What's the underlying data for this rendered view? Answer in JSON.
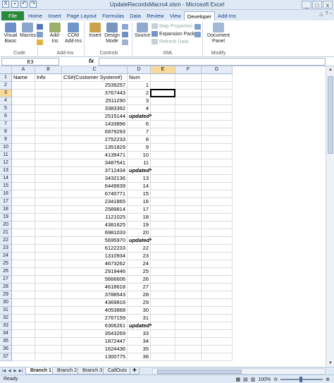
{
  "window": {
    "title": "UpdateRecordsMacro4.xlsm - Microsoft Excel",
    "buttons": [
      "_",
      "□",
      "x"
    ]
  },
  "quick_access": [
    "save-icon",
    "undo-icon",
    "redo-icon"
  ],
  "ribbon_tabs": [
    "File",
    "Home",
    "Insert",
    "Page Layout",
    "Formulas",
    "Data",
    "Review",
    "View",
    "Developer",
    "Add-Ins"
  ],
  "active_tab": "Developer",
  "ribbon": {
    "code": {
      "label": "Code",
      "visual_basic": "Visual\nBasic",
      "macros": "Macros"
    },
    "addins": {
      "label": "Add-Ins",
      "addins": "Add-Ins",
      "com": "COM\nAdd-Ins"
    },
    "controls": {
      "label": "Controls",
      "insert": "Insert",
      "design": "Design\nMode"
    },
    "xml": {
      "label": "XML",
      "source": "Source",
      "map_properties": "Map Properties",
      "expansion_packs": "Expansion Packs",
      "refresh_data": "Refresh Data"
    },
    "modify": {
      "label": "Modify",
      "document_panel": "Document\nPanel"
    }
  },
  "formula_bar": {
    "name_box": "E3",
    "fx": "fx",
    "value": ""
  },
  "columns": [
    "A",
    "B",
    "C",
    "D",
    "E",
    "F",
    "G"
  ],
  "selected_column": "E",
  "selected_row": 3,
  "rows": [
    {
      "n": 1,
      "a": "Name",
      "b": "Info",
      "c": "CS#(Customer System#)",
      "d": "Num"
    },
    {
      "n": 2,
      "c": "2539257",
      "d": "1"
    },
    {
      "n": 3,
      "c": "3767443",
      "d": "2"
    },
    {
      "n": 4,
      "c": "2511290",
      "d": "3"
    },
    {
      "n": 5,
      "c": "3383392",
      "d": "4"
    },
    {
      "n": 6,
      "c": "2515144",
      "d": "updated*"
    },
    {
      "n": 7,
      "c": "1433896",
      "d": "6"
    },
    {
      "n": 8,
      "c": "6979293",
      "d": "7"
    },
    {
      "n": 9,
      "c": "2752233",
      "d": "8"
    },
    {
      "n": 10,
      "c": "1351829",
      "d": "9"
    },
    {
      "n": 11,
      "c": "4139471",
      "d": "10"
    },
    {
      "n": 12,
      "c": "3487541",
      "d": "11"
    },
    {
      "n": 13,
      "c": "3712434",
      "d": "updated*"
    },
    {
      "n": 14,
      "c": "3432136",
      "d": "13"
    },
    {
      "n": 15,
      "c": "6449639",
      "d": "14"
    },
    {
      "n": 16,
      "c": "6740771",
      "d": "15"
    },
    {
      "n": 17,
      "c": "2341865",
      "d": "16"
    },
    {
      "n": 18,
      "c": "2589814",
      "d": "17"
    },
    {
      "n": 19,
      "c": "1121025",
      "d": "18"
    },
    {
      "n": 20,
      "c": "4381625",
      "d": "19"
    },
    {
      "n": 21,
      "c": "6981033",
      "d": "20"
    },
    {
      "n": 22,
      "c": "5695970",
      "d": "updated*"
    },
    {
      "n": 23,
      "c": "6122233",
      "d": "22"
    },
    {
      "n": 24,
      "c": "1310934",
      "d": "23"
    },
    {
      "n": 25,
      "c": "4673262",
      "d": "24"
    },
    {
      "n": 26,
      "c": "2919446",
      "d": "25"
    },
    {
      "n": 27,
      "c": "5666606",
      "d": "26"
    },
    {
      "n": 28,
      "c": "4618618",
      "d": "27"
    },
    {
      "n": 29,
      "c": "3788543",
      "d": "28"
    },
    {
      "n": 30,
      "c": "4369816",
      "d": "29"
    },
    {
      "n": 31,
      "c": "4053868",
      "d": "30"
    },
    {
      "n": 32,
      "c": "2767159",
      "d": "31"
    },
    {
      "n": 33,
      "c": "6306261",
      "d": "updated*"
    },
    {
      "n": 34,
      "c": "3543269",
      "d": "33"
    },
    {
      "n": 35,
      "c": "1872447",
      "d": "34"
    },
    {
      "n": 36,
      "c": "1624436",
      "d": "35"
    },
    {
      "n": 37,
      "c": "1300775",
      "d": "36"
    }
  ],
  "sheet_tabs": [
    "Branch 1",
    "Branch 2",
    "Branch 3",
    "CallOuts"
  ],
  "active_sheet": "Branch 1",
  "status": {
    "ready": "Ready",
    "zoom": "100%"
  }
}
